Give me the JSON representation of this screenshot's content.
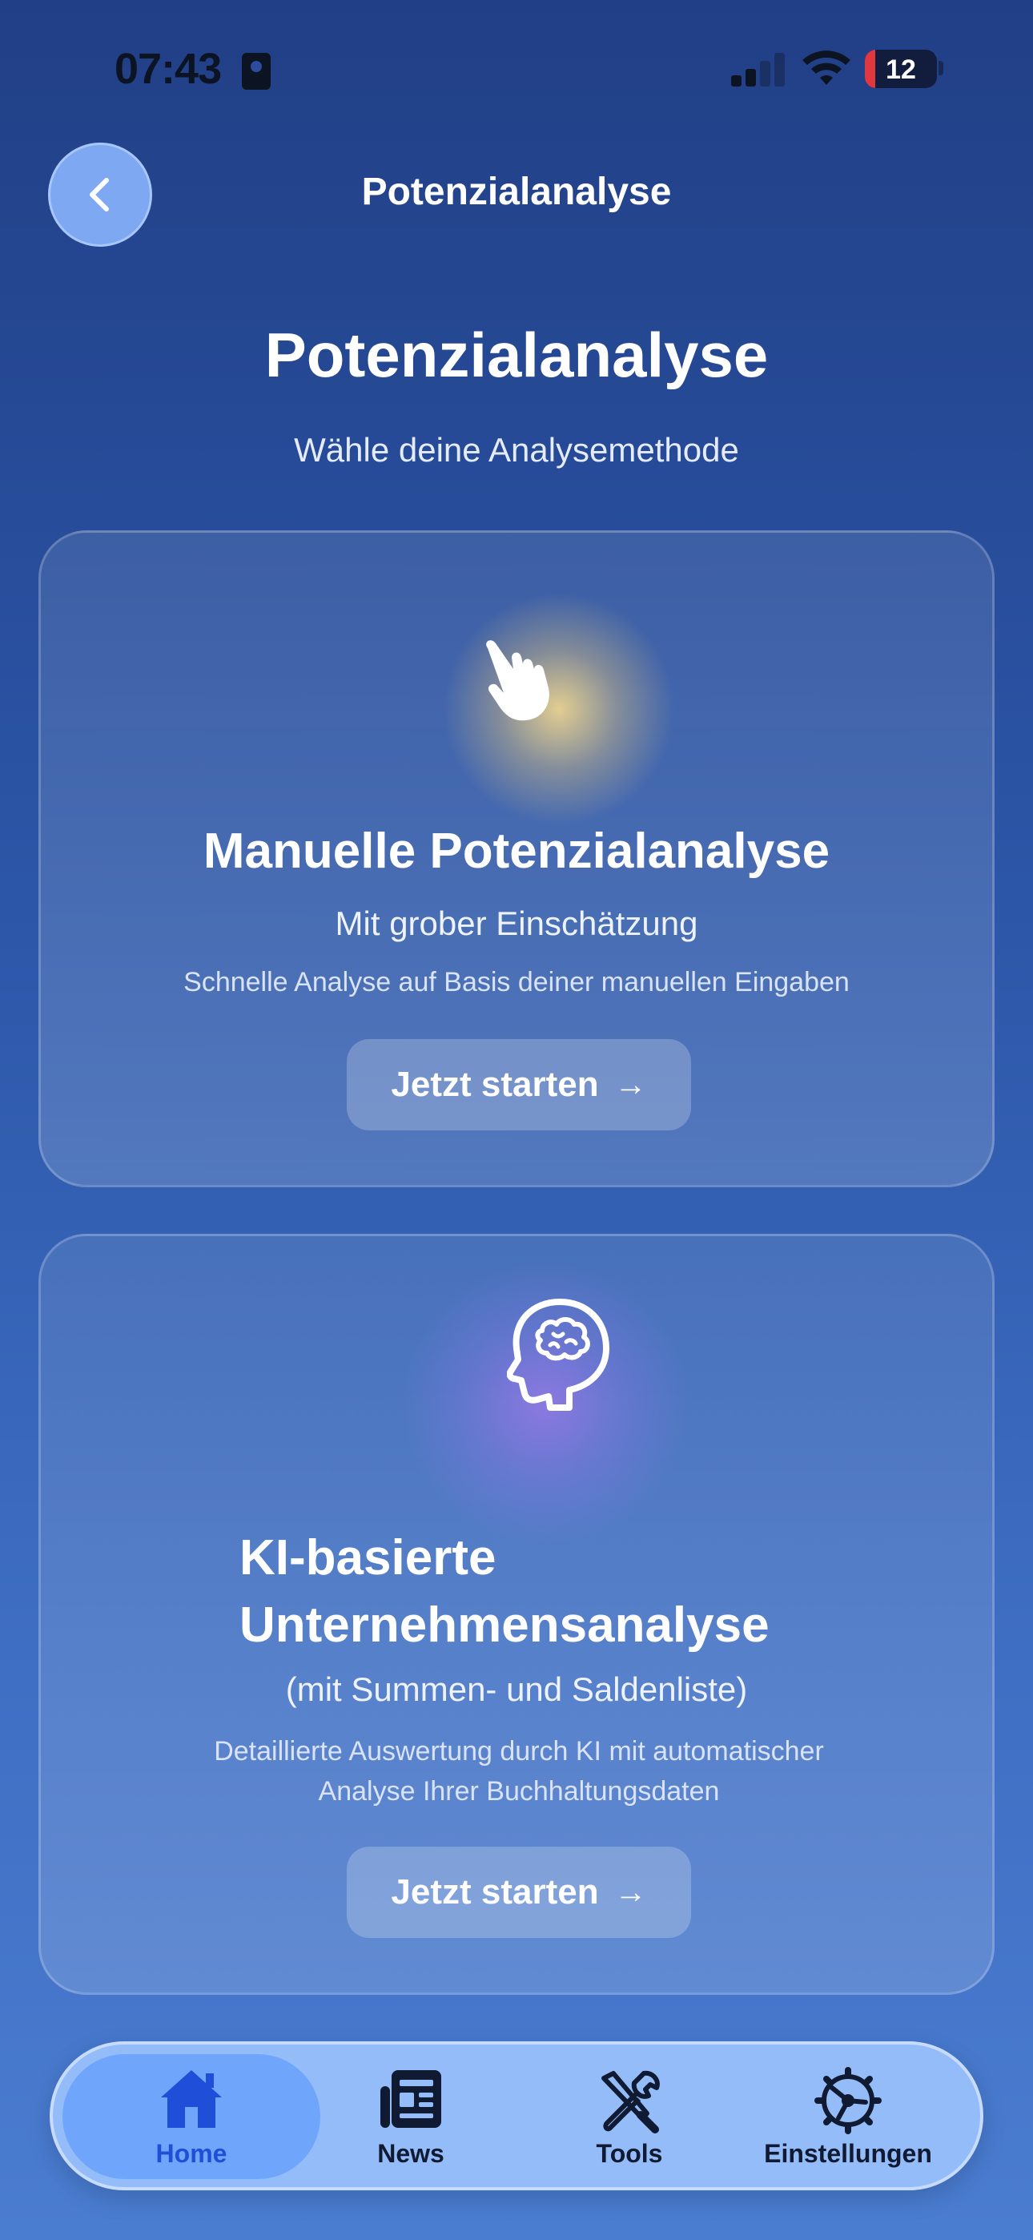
{
  "status_bar": {
    "time": "07:43",
    "battery": "12"
  },
  "header": {
    "title": "Potenzialanalyse"
  },
  "page": {
    "title": "Potenzialanalyse",
    "subtitle": "Wähle deine Analysemethode"
  },
  "cards": [
    {
      "icon": "pointing-hand-icon",
      "title": "Manuelle Potenzialanalyse",
      "subtitle": "Mit grober Einschätzung",
      "description": "Schnelle Analyse auf Basis deiner manuellen Eingaben",
      "button_label": "Jetzt starten",
      "button_arrow": "→"
    },
    {
      "icon": "brain-head-icon",
      "title_line1": "KI-basierte",
      "title_line2": "Unternehmensanalyse",
      "subtitle": "(mit Summen- und Saldenliste)",
      "description_line1": "Detaillierte Auswertung durch KI mit automatischer",
      "description_line2": "Analyse Ihrer Buchhaltungsdaten",
      "button_label": "Jetzt starten",
      "button_arrow": "→"
    }
  ],
  "tabbar": {
    "active": "Home",
    "items": [
      {
        "label": "Home",
        "icon": "house-icon"
      },
      {
        "label": "News",
        "icon": "newspaper-icon"
      },
      {
        "label": "Tools",
        "icon": "tools-icon"
      },
      {
        "label": "Einstellungen",
        "icon": "gear-icon"
      }
    ]
  },
  "colors": {
    "background_top": "#213f86",
    "background_bottom": "#4a7cd0",
    "tab_active": "#6fa6fb",
    "tab_active_label": "#1f4fd8",
    "battery_low": "#e0383e"
  }
}
